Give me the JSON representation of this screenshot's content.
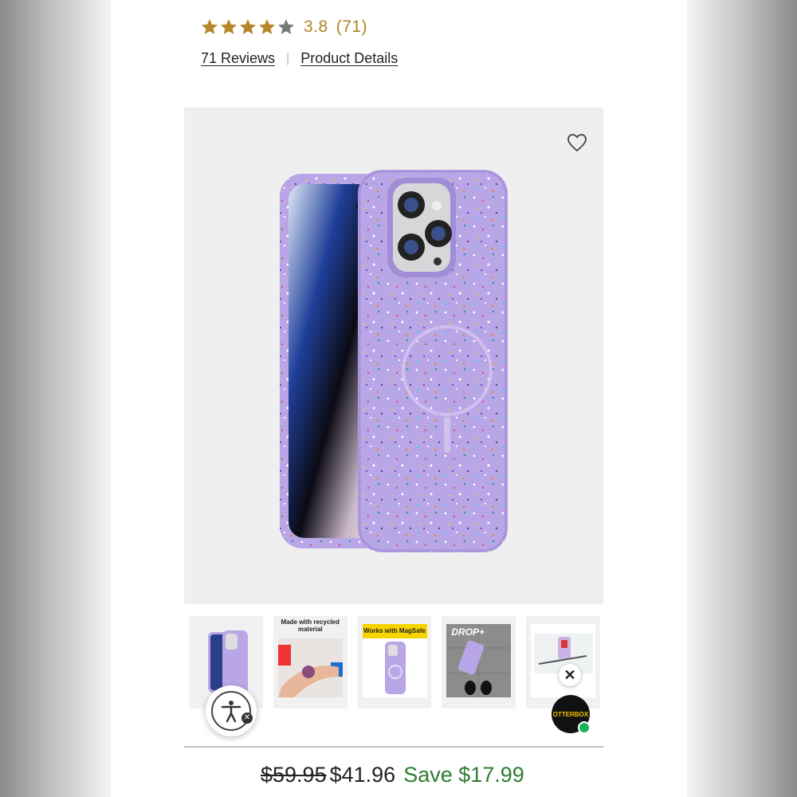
{
  "rating": {
    "value": "3.8",
    "count_text": "(71)",
    "stars_filled": 4,
    "stars_total": 5,
    "star_color": "#b5862a",
    "star_empty_color": "#7a7a7a"
  },
  "links": {
    "reviews": "71 Reviews",
    "details": "Product Details"
  },
  "product_image": {
    "icon": "heart-icon",
    "case_color": "#b9a6e6",
    "background": "#efefef"
  },
  "thumbnails": [
    {
      "caption": ""
    },
    {
      "caption": "Made with recycled material"
    },
    {
      "caption": "Works with MagSafe"
    },
    {
      "caption": "DROP+"
    },
    {
      "caption": ""
    }
  ],
  "chat": {
    "brand": "OTTERBOX",
    "close_symbol": "✕",
    "status_color": "#17b35a"
  },
  "accessibility": {
    "close_symbol": "✕"
  },
  "price": {
    "original": "$59.95",
    "current": "$41.96",
    "savings": "Save $17.99",
    "savings_color": "#2e7d32"
  }
}
